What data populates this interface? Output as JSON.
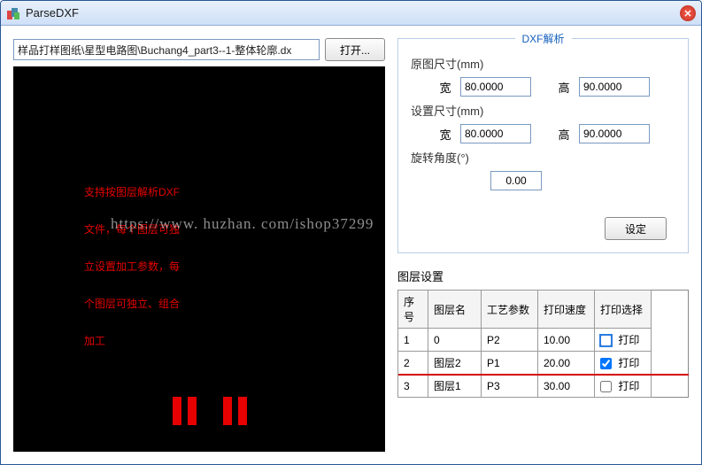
{
  "window": {
    "title": "ParseDXF"
  },
  "path": {
    "value": "样品打样图纸\\星型电路图\\Buchang4_part3--1-整体轮廓.dx"
  },
  "buttons": {
    "open": "打开...",
    "set": "设定"
  },
  "panel": {
    "legend": "DXF解析",
    "origDimLabel": "原图尺寸(mm)",
    "setDimLabel": "设置尺寸(mm)",
    "widthLabel": "宽",
    "heightLabel": "高",
    "rotationLabel": "旋转角度(°)",
    "origW": "80.0000",
    "origH": "90.0000",
    "setW": "80.0000",
    "setH": "90.0000",
    "rotation": "0.00"
  },
  "overlay": {
    "line1": "支持按图层解析DXF",
    "line2": "文件，每个图层可独",
    "line3": "立设置加工参数，每",
    "line4": "个图层可独立、组合",
    "line5": "加工"
  },
  "watermark": "https://www. huzhan. com/ishop37299",
  "layer": {
    "title": "图层设置",
    "headers": {
      "seq": "序号",
      "name": "图层名",
      "proc": "工艺参数",
      "speed": "打印速度",
      "sel": "打印选择"
    },
    "rows": [
      {
        "seq": "1",
        "name": "0",
        "proc": "P2",
        "speed": "10.00",
        "checked": false,
        "selText": "打印",
        "selected": true
      },
      {
        "seq": "2",
        "name": "图层2",
        "proc": "P1",
        "speed": "20.00",
        "checked": true,
        "selText": "打印",
        "redline": true
      },
      {
        "seq": "3",
        "name": "图层1",
        "proc": "P3",
        "speed": "30.00",
        "checked": false,
        "selText": "打印"
      }
    ]
  }
}
